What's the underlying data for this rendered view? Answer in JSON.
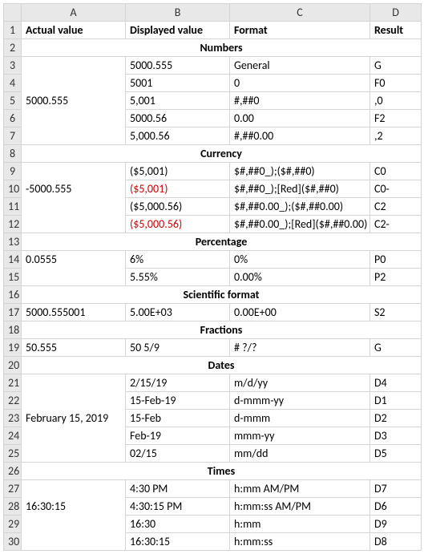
{
  "columns": {
    "A": "A",
    "B": "B",
    "C": "C",
    "D": "D"
  },
  "header": {
    "A": "Actual value",
    "B": "Displayed value",
    "C": "Format",
    "D": "Result"
  },
  "sections": {
    "numbers": "Numbers",
    "currency": "Currency",
    "percentage": "Percentage",
    "scientific": "Scientific format",
    "fractions": "Fractions",
    "dates": "Dates",
    "times": "Times"
  },
  "numbers": {
    "actual": "5000.555",
    "rows": [
      {
        "disp": "5000.555",
        "fmt": "General",
        "res": "G"
      },
      {
        "disp": "5001",
        "fmt": "0",
        "res": "F0"
      },
      {
        "disp": "5,001",
        "fmt": "#,##0",
        "res": ",0"
      },
      {
        "disp": "5000.56",
        "fmt": "0.00",
        "res": "F2"
      },
      {
        "disp": "5,000.56",
        "fmt": "#,##0.00",
        "res": ",2"
      }
    ]
  },
  "currency": {
    "actual": "-5000.555",
    "rows": [
      {
        "disp": "($5,001)",
        "fmt": "$#,##0_);($#,##0)",
        "res": "C0",
        "red": false
      },
      {
        "disp": "($5,001)",
        "fmt": "$#,##0_);[Red]($#,##0)",
        "res": "C0-",
        "red": true
      },
      {
        "disp": "($5,000.56)",
        "fmt": "$#,##0.00_);($#,##0.00)",
        "res": "C2",
        "red": false
      },
      {
        "disp": "($5,000.56)",
        "fmt": "$#,##0.00_);[Red]($#,##0.00)",
        "res": "C2-",
        "red": true
      }
    ]
  },
  "percentage": {
    "actual": "0.0555",
    "rows": [
      {
        "disp": "6%",
        "fmt": "0%",
        "res": "P0"
      },
      {
        "disp": "5.55%",
        "fmt": "0.00%",
        "res": "P2"
      }
    ]
  },
  "scientific": {
    "actual": "5000.555001",
    "rows": [
      {
        "disp": "5.00E+03",
        "fmt": "0.00E+00",
        "res": "S2"
      }
    ]
  },
  "fractions": {
    "actual": "50.555",
    "rows": [
      {
        "disp": "50 5/9",
        "fmt": "# ?/?",
        "res": "G"
      }
    ]
  },
  "dates": {
    "actual": "February 15, 2019",
    "rows": [
      {
        "disp": "2/15/19",
        "fmt": "m/d/yy",
        "res": "D4"
      },
      {
        "disp": "15-Feb-19",
        "fmt": "d-mmm-yy",
        "res": "D1"
      },
      {
        "disp": "15-Feb",
        "fmt": "d-mmm",
        "res": "D2"
      },
      {
        "disp": "Feb-19",
        "fmt": "mmm-yy",
        "res": "D3"
      },
      {
        "disp": "02/15",
        "fmt": "mm/dd",
        "res": "D5"
      }
    ]
  },
  "times": {
    "actual": "16:30:15",
    "rows": [
      {
        "disp": "4:30 PM",
        "fmt": "h:mm AM/PM",
        "res": "D7"
      },
      {
        "disp": "4:30:15 PM",
        "fmt": "h:mm:ss AM/PM",
        "res": "D6"
      },
      {
        "disp": "16:30",
        "fmt": "h:mm",
        "res": "D9"
      },
      {
        "disp": "16:30:15",
        "fmt": "h:mm:ss",
        "res": "D8"
      }
    ]
  },
  "rownums": [
    "1",
    "2",
    "3",
    "4",
    "5",
    "6",
    "7",
    "8",
    "9",
    "10",
    "11",
    "12",
    "13",
    "14",
    "15",
    "16",
    "17",
    "18",
    "19",
    "20",
    "21",
    "22",
    "23",
    "24",
    "25",
    "26",
    "27",
    "28",
    "29",
    "30"
  ]
}
